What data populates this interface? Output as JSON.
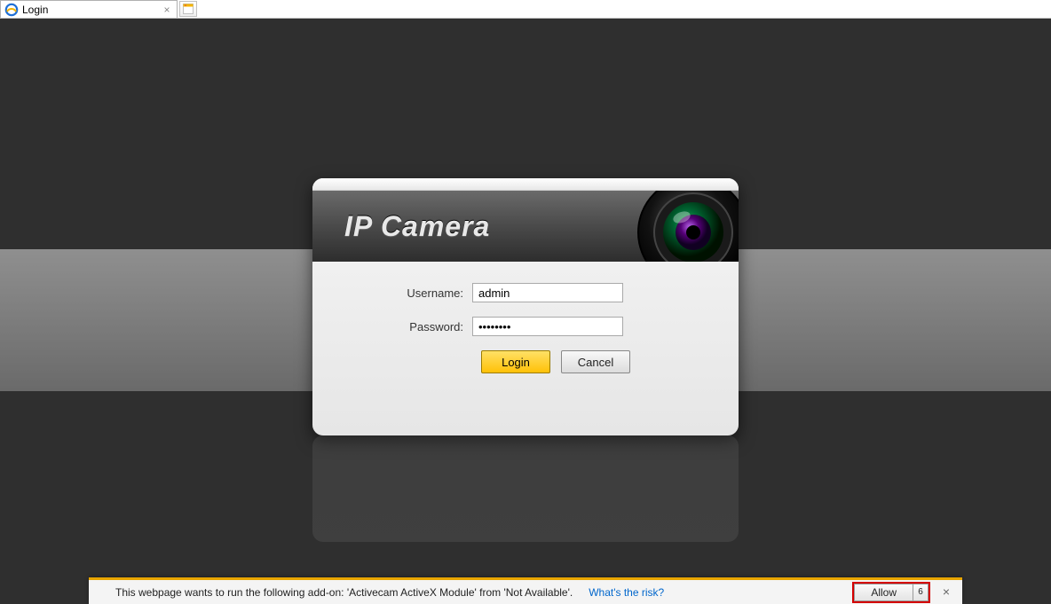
{
  "browser": {
    "tab_title": "Login"
  },
  "header": {
    "title": "IP Camera"
  },
  "form": {
    "username_label": "Username:",
    "password_label": "Password:",
    "username_value": "admin",
    "password_value": "••••••••",
    "login_label": "Login",
    "cancel_label": "Cancel"
  },
  "notification": {
    "message": "This webpage wants to run the following add-on: 'Activecam ActiveX Module' from 'Not Available'.",
    "risk_link": "What's the risk?",
    "allow_label": "Allow",
    "allow_count": "6"
  }
}
